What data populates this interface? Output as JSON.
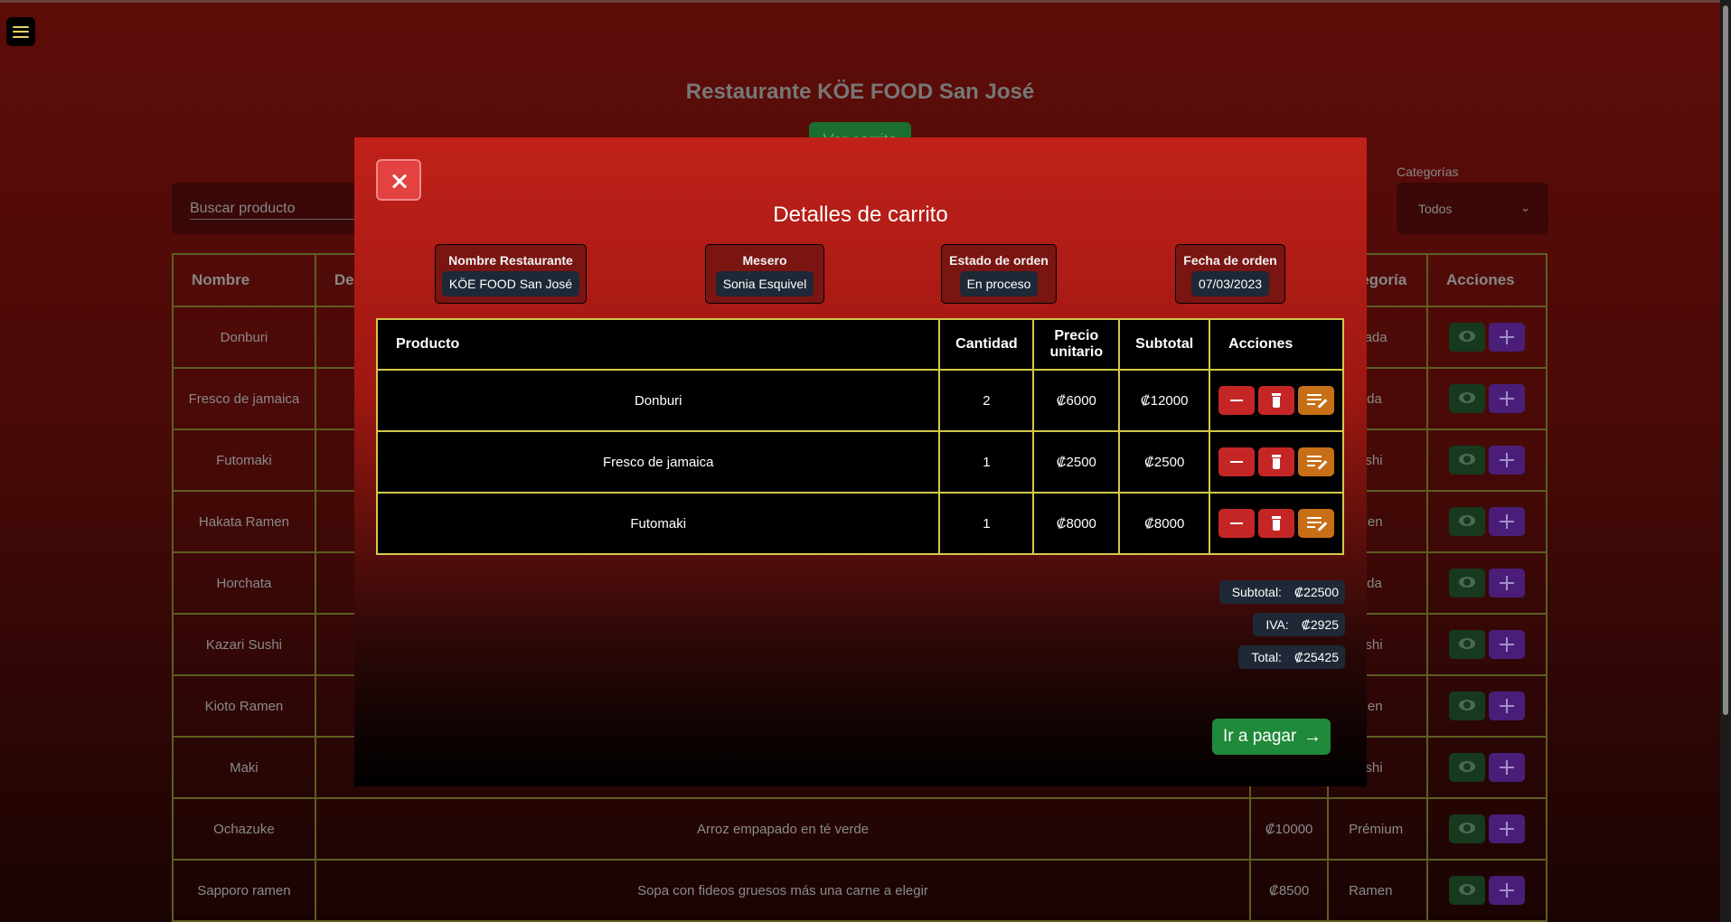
{
  "page": {
    "title": "Restaurante KÖE FOOD San José",
    "cart_button": "Ver carrito",
    "search_placeholder": "Buscar producto",
    "category_label": "Categorías",
    "category_value": "Todos"
  },
  "bg_table": {
    "headers": [
      "Nombre",
      "Des",
      "",
      "ategoría",
      "Acciones"
    ],
    "rows": [
      {
        "name": "Donburi",
        "desc": "",
        "price": "",
        "cat": "ntrada"
      },
      {
        "name": "Fresco de jamaica",
        "desc": "",
        "price": "",
        "cat": "ebida"
      },
      {
        "name": "Futomaki",
        "desc": "",
        "price": "",
        "cat": "Sushi"
      },
      {
        "name": "Hakata Ramen",
        "desc": "",
        "price": "",
        "cat": "amen"
      },
      {
        "name": "Horchata",
        "desc": "",
        "price": "",
        "cat": "ebida"
      },
      {
        "name": "Kazari Sushi",
        "desc": "",
        "price": "",
        "cat": "Sushi"
      },
      {
        "name": "Kioto Ramen",
        "desc": "",
        "price": "",
        "cat": "amen"
      },
      {
        "name": "Maki",
        "desc": "",
        "price": "",
        "cat": "Sushi"
      },
      {
        "name": "Ochazuke",
        "desc": "Arroz empapado en té verde",
        "price": "₡10000",
        "cat": "Prémium"
      },
      {
        "name": "Sapporo ramen",
        "desc": "Sopa con fideos gruesos más una carne a elegir",
        "price": "₡8500",
        "cat": "Ramen"
      }
    ]
  },
  "modal": {
    "title": "Detalles de carrito",
    "info": {
      "restaurant_label": "Nombre Restaurante",
      "restaurant_value": "KÖE FOOD San José",
      "waiter_label": "Mesero",
      "waiter_value": "Sonia Esquivel",
      "status_label": "Estado de orden",
      "status_value": "En proceso",
      "date_label": "Fecha de orden",
      "date_value": "07/03/2023"
    },
    "table": {
      "headers": [
        "Producto",
        "Cantidad",
        "Precio unitario",
        "Subtotal",
        "Acciones"
      ],
      "rows": [
        {
          "product": "Donburi",
          "qty": "2",
          "unit": "₡6000",
          "subtotal": "₡12000"
        },
        {
          "product": "Fresco de jamaica",
          "qty": "1",
          "unit": "₡2500",
          "subtotal": "₡2500"
        },
        {
          "product": "Futomaki",
          "qty": "1",
          "unit": "₡8000",
          "subtotal": "₡8000"
        }
      ]
    },
    "summary": {
      "subtotal_label": "Subtotal:",
      "subtotal_value": "₡22500",
      "iva_label": "IVA:",
      "iva_value": "₡2925",
      "total_label": "Total:",
      "total_value": "₡25425"
    },
    "pay_button": "Ir a pagar",
    "icons": {
      "close": "close-icon",
      "minus": "minus-icon",
      "trash": "trash-icon",
      "edit": "edit-note-icon",
      "arrow": "arrow-right-icon"
    }
  }
}
